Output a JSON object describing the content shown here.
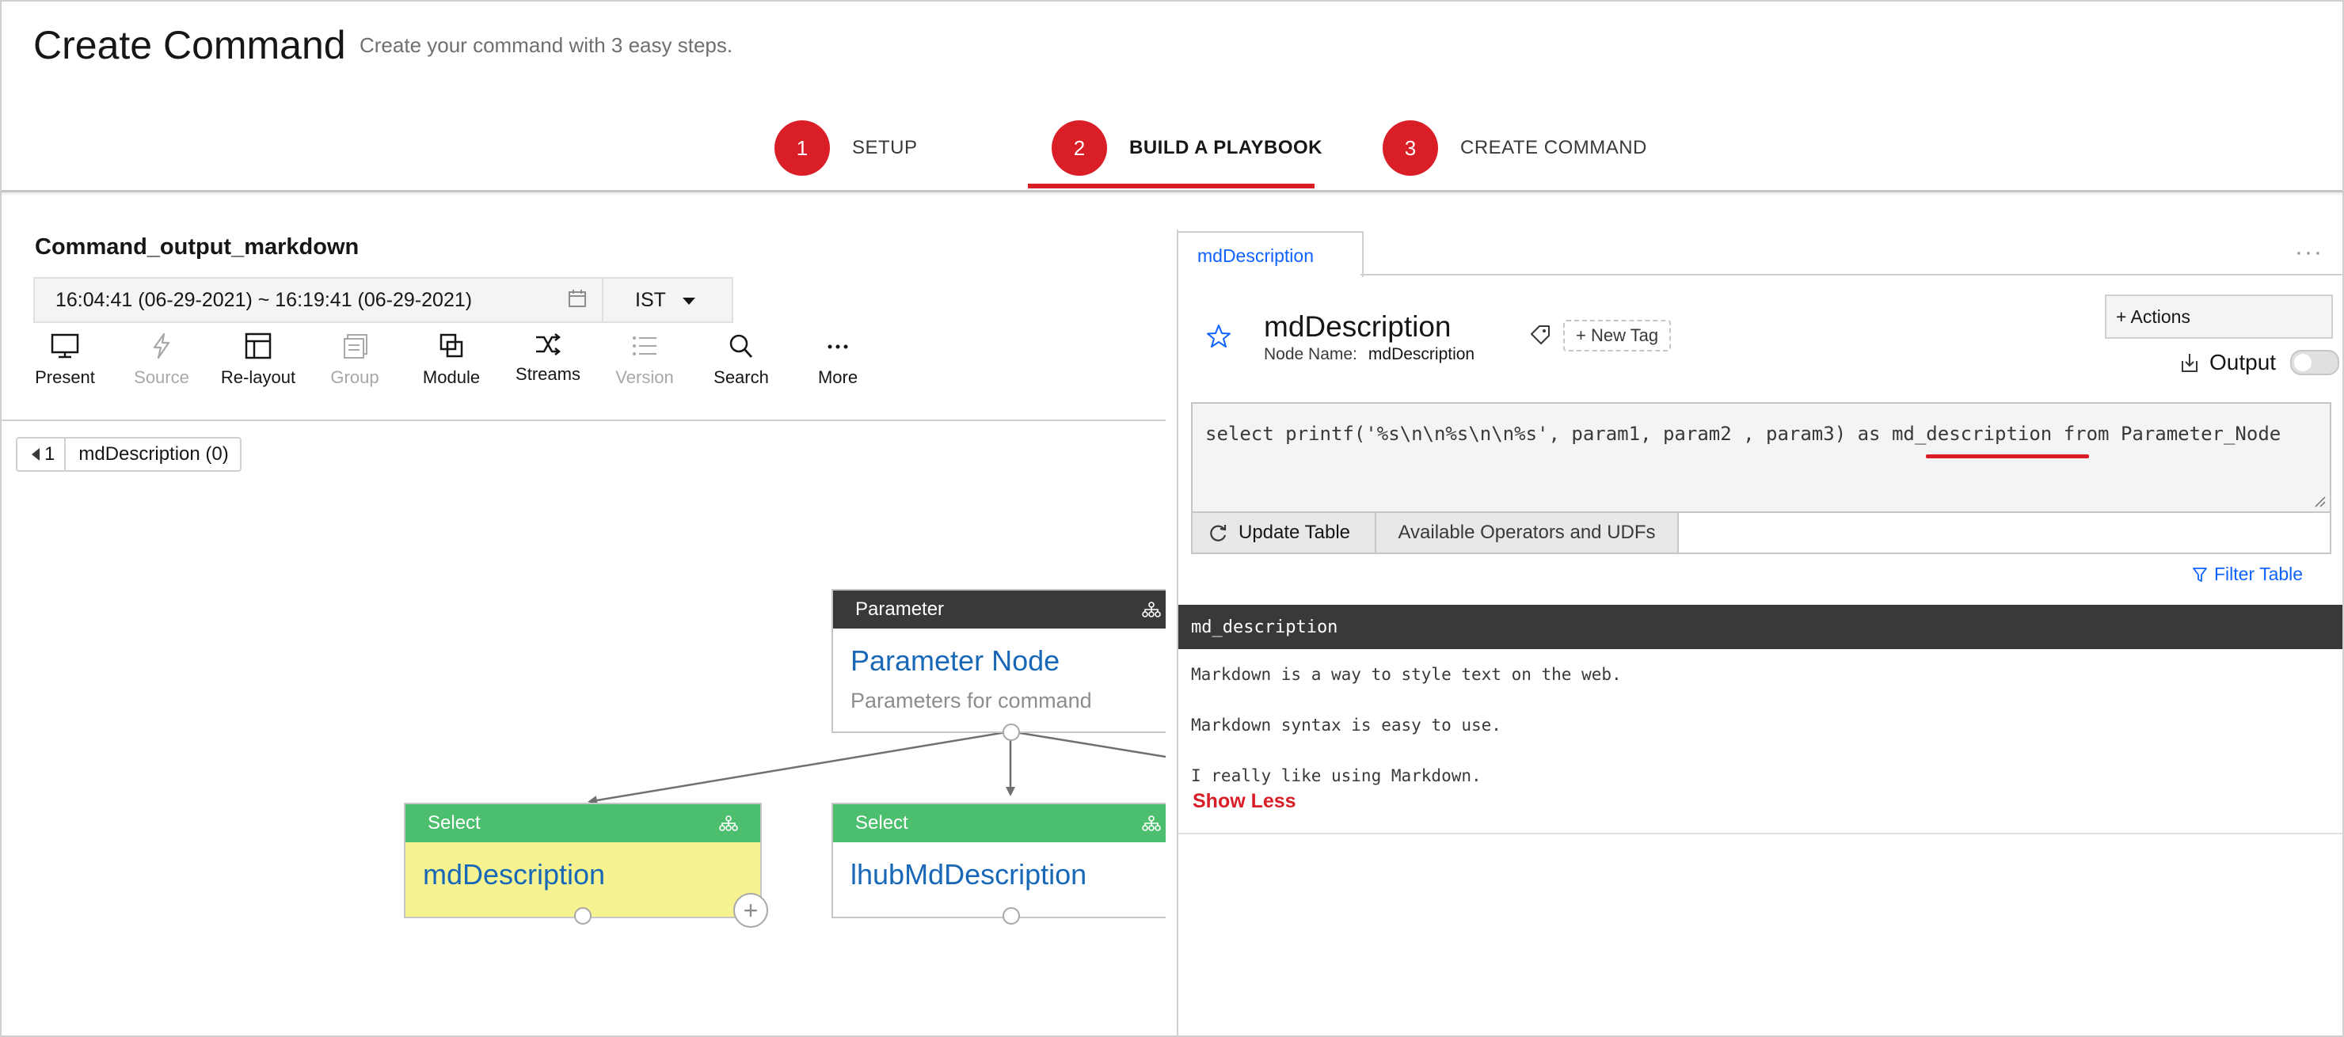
{
  "header": {
    "title": "Create Command",
    "subtitle": "Create your command with 3 easy steps."
  },
  "steps": [
    {
      "number": "1",
      "label": "SETUP"
    },
    {
      "number": "2",
      "label": "BUILD A PLAYBOOK"
    },
    {
      "number": "3",
      "label": "CREATE COMMAND"
    }
  ],
  "active_step": 2,
  "playbook": {
    "name": "Command_output_markdown",
    "time_range": "16:04:41 (06-29-2021)  ~ 16:19:41 (06-29-2021)",
    "timezone": "IST"
  },
  "toolbar": [
    {
      "label": "Present",
      "icon": "monitor-icon",
      "disabled": false
    },
    {
      "label": "Source",
      "icon": "lightning-icon",
      "disabled": true
    },
    {
      "label": "Re-layout",
      "icon": "layout-icon",
      "disabled": false
    },
    {
      "label": "Group",
      "icon": "group-icon",
      "disabled": true
    },
    {
      "label": "Module",
      "icon": "module-icon",
      "disabled": false
    },
    {
      "label": "Streams",
      "icon": "shuffle-icon",
      "disabled": false
    },
    {
      "label": "Version",
      "icon": "list-icon",
      "disabled": true
    },
    {
      "label": "Search",
      "icon": "search-icon",
      "disabled": false
    },
    {
      "label": "More",
      "icon": "more-icon",
      "disabled": false
    }
  ],
  "breadcrumb": {
    "back": "1",
    "label": "mdDescription (0)"
  },
  "nodes": {
    "parameter": {
      "type": "Parameter",
      "name": "Parameter Node",
      "description": "Parameters for command"
    },
    "select_md": {
      "type": "Select",
      "name": "mdDescription"
    },
    "select_lhub": {
      "type": "Select",
      "name": "lhubMdDescription"
    }
  },
  "right_panel": {
    "tab": "mdDescription",
    "title": "mdDescription",
    "node_name_label": "Node Name:",
    "node_name_value": "mdDescription",
    "new_tag": "+ New Tag",
    "actions": "+ Actions",
    "output_label": "Output",
    "output_enabled": false,
    "query": "select printf('%s\\n\\n%s\\n\\n%s', param1, param2 , param3) as md_description from Parameter_Node",
    "update_table": "Update Table",
    "operators": "Available Operators and UDFs",
    "filter_table": "Filter Table",
    "result_column": "md_description",
    "result_value": "Markdown is a way to style text on the web.\n\nMarkdown syntax is easy to use.\n\nI really like using Markdown.",
    "show_less": "Show Less"
  },
  "colors": {
    "accent_red": "#da1e28",
    "link_blue": "#0f62fe",
    "parameter_header": "#393939",
    "select_header": "#4cbf6f",
    "selected_node_body": "#f7f390"
  }
}
